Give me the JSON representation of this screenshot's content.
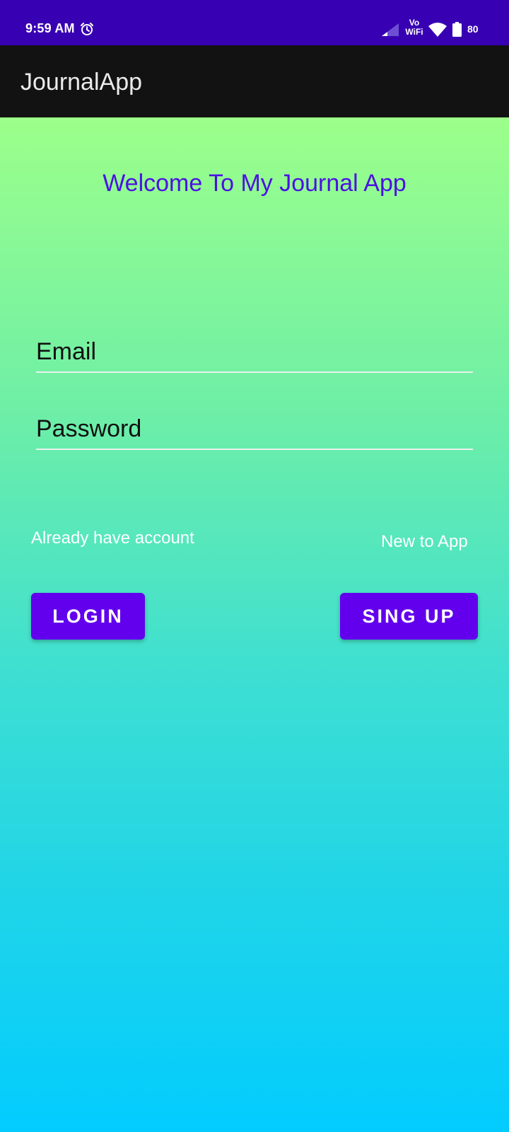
{
  "status_bar": {
    "time": "9:59 AM",
    "network_line1": "Vo",
    "network_line2": "WiFi",
    "battery": "80",
    "background": "#3800b3"
  },
  "app_bar": {
    "title": "JournalApp",
    "background": "#121212"
  },
  "main": {
    "welcome": "Welcome To My Journal App",
    "welcome_color": "#4b12e2",
    "email_placeholder": "Email",
    "email_value": "",
    "password_placeholder": "Password",
    "password_value": "",
    "login_hint": "Already have account",
    "signup_hint": "New to App",
    "login_label": "LOGIN",
    "signup_label": "SING UP",
    "button_color": "#6200ee",
    "gradient_top": "#9cff8a",
    "gradient_bottom": "#02ccff"
  }
}
